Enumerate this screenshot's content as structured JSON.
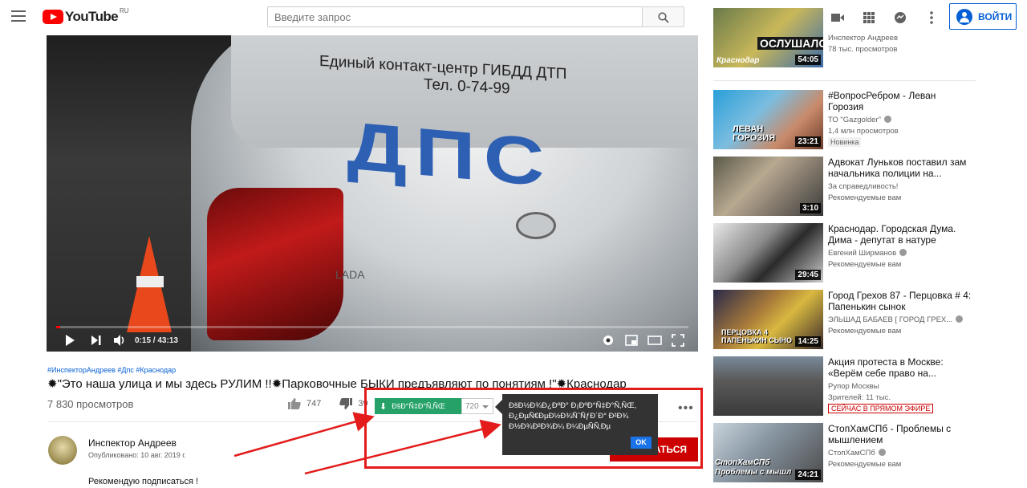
{
  "header": {
    "logo_text": "YouTube",
    "logo_region": "RU",
    "search_placeholder": "Введите запрос",
    "signin_label": "ВОЙТИ"
  },
  "player": {
    "car_text_line1": "Единый контакт-центр ГИБДД ДТП",
    "car_text_line2": "Тел.    0-74-99",
    "car_dps": "ДПС",
    "lada_text": "LADA",
    "time_current": "0:15",
    "time_sep": " / ",
    "time_total": "43:13",
    "progress_fraction": 0.0058
  },
  "video": {
    "hashtags": "#ИнспекторАндреев #Дпс #Краснодар",
    "title": "✹\"Это наша улица и мы здесь РУЛИМ !!✹Парковочные БЫКИ предъявляют по понятиям !\"✹Краснодар",
    "views": "7 830 просмотров",
    "likes": "747",
    "dislikes": "39"
  },
  "owner": {
    "name": "Инспектор Андреев",
    "published": "Опубликовано: 10 авг. 2019 г.",
    "description": "Рекомендую подписаться !",
    "subscribe_label": "АТЬСЯ"
  },
  "extension": {
    "download_label": "ÐšÐ°Ñ‡Ð°Ñ‚ÑŒ",
    "quality": "720",
    "popup_text": "ÐšÐ½Ð¾Ð¿ÐºÐ° Ð¡ÐºÐ°Ñ‡Ð°Ñ‚ÑŒ, Ð¿ÐµÑ€ÐµÐ½Ð¾ÑˆÑƒÐ´Ð° Ð²Ð¾ Ð½Ð¾Ð²Ð¾Ð¼ Ð¼ÐµÑÑ‚Ðµ",
    "ok_label": "OK"
  },
  "sidebar": {
    "items": [
      {
        "title": "",
        "channel": "Инспектор Андреев",
        "meta": "78 тыс. просмотров",
        "duration": "54:05",
        "thumb_text": "ОСЛУШАЛСЯ",
        "thumb_sub": "Краснодар"
      },
      {
        "title": "#ВопросРебром - Леван Горозия",
        "channel": "ТО \"Gazgolder\"",
        "meta": "1,4 млн просмотров",
        "badge": "Новинка",
        "duration": "23:21",
        "thumb_text": "ЛЕВАН ГОРОЗИЯ"
      },
      {
        "title": "Адвокат Луньков поставил зам начальника полиции на...",
        "channel": "За справедливость!",
        "meta": "Рекомендуемые вам",
        "duration": "3:10"
      },
      {
        "title": "Краснодар. Городская Дума. Дима - депутат в натуре",
        "channel": "Евгений Ширманов",
        "meta": "Рекомендуемые вам",
        "duration": "29:45"
      },
      {
        "title": "Город Грехов 87 - Перцовка # 4: Папенькин сынок",
        "channel": "ЭЛЬШАД БАБАЕВ [ ГОРОД ГРЕХ...",
        "meta": "Рекомендуемые вам",
        "duration": "14:25",
        "thumb_text": "ПЕРЦОВКА  4 ПАПЕНЬКИН СЫНО"
      },
      {
        "title": "Акция протеста в Москве: «Верём себе право на...",
        "channel": "Рупор Москвы",
        "meta": "Зрителей: 11 тыс.",
        "badge_live": "СЕЙЧАС В ПРЯМОМ ЭФИРЕ"
      },
      {
        "title": "СтопХамСПб - Проблемы с мышлением",
        "channel": "СтопХамСПб",
        "meta": "Рекомендуемые вам",
        "duration": "24:21",
        "thumb_text": "СтопХамСПб Проблемы с мышл"
      }
    ]
  },
  "colors": {
    "brand_red": "#ff0000",
    "link_blue": "#065fd4",
    "download_green": "#26a269",
    "annotation_red": "#e31b1b"
  }
}
